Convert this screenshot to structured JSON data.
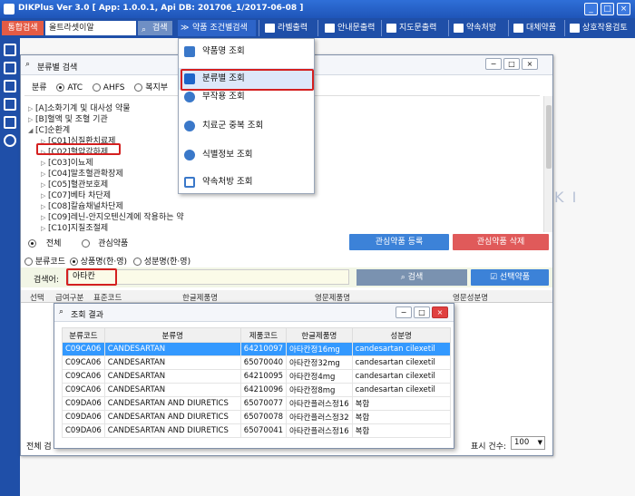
{
  "app": {
    "title": "DIKPlus Ver 3.0 [ App: 1.0.0.1, Api DB: 201706_1/2017-06-08 ]"
  },
  "toolbar": {
    "integrated_search": "통합검색",
    "search_value": "올트라셋이알",
    "search_btn": "검색",
    "drug_condition_search": "약품 조건별검색",
    "label_print": "라벨출력",
    "guide_print": "안내문출력",
    "guidance_print": "지도문출력",
    "contract_prescription": "약속처방",
    "substitute_drug": "대체약품",
    "interaction_review": "상호작용검토"
  },
  "dropdown": {
    "items": [
      "약품명 조회",
      "분류별 조회",
      "부작용 조회",
      "치료군 중복 조회",
      "식별정보 조회",
      "약속처방 조회"
    ]
  },
  "classwin": {
    "title": "분류별 검색",
    "cls_label": "분류",
    "opt_atc": "ATC",
    "opt_ahfs": "AHFS",
    "opt_welfare": "복지부",
    "tree": [
      "[A]소화기계 및 대사성 약물",
      "[B]혈액 및 조혈 기관",
      "[C]순환계",
      "[C01]심질환치료제",
      "[C02]혈압강하제",
      "[C03]이뇨제",
      "[C04]말초혈관확장제",
      "[C05]혈관보호제",
      "[C07]베타 차단제",
      "[C08]칼슘채널차단제",
      "[C09]레닌-안지오텐신계에 작용하는 약",
      "[C10]지질조절제"
    ],
    "all": "전체",
    "interest": "관심약품",
    "btn_add_interest": "관심약품 등록",
    "btn_del_interest": "관심약품 삭제",
    "opt_class_code": "분류코드",
    "opt_product_name": "상품명(한·영)",
    "opt_ingredient": "성분명(한·영)",
    "search_label": "검색어:",
    "search_value": "아타칸",
    "btn_search": "검색",
    "btn_select": "선택약품",
    "grid_headers": [
      "선택",
      "급여구분",
      "표준코드",
      "한글제품명",
      "영문제품명",
      "영문성분명"
    ],
    "footer_all": "전체 검",
    "display_count_label": "표시 건수:",
    "display_count_value": "100"
  },
  "popup": {
    "title": "조회 결과",
    "headers": [
      "분류코드",
      "분류명",
      "제품코드",
      "한글제품명",
      "성분명"
    ],
    "rows": [
      [
        "C09CA06",
        "CANDESARTAN",
        "64210097",
        "아타칸정16mg",
        "candesartan cilexetil"
      ],
      [
        "C09CA06",
        "CANDESARTAN",
        "65070040",
        "아타칸정32mg",
        "candesartan cilexetil"
      ],
      [
        "C09CA06",
        "CANDESARTAN",
        "64210095",
        "아타칸정4mg",
        "candesartan cilexetil"
      ],
      [
        "C09CA06",
        "CANDESARTAN",
        "64210096",
        "아타칸정8mg",
        "candesartan cilexetil"
      ],
      [
        "C09DA06",
        "CANDESARTAN AND DIURETICS",
        "65070077",
        "아타칸플러스정16",
        "복합"
      ],
      [
        "C09DA06",
        "CANDESARTAN AND DIURETICS",
        "65070078",
        "아타칸플러스정32",
        "복합"
      ],
      [
        "C09DA06",
        "CANDESARTAN AND DIURETICS",
        "65070041",
        "아타칸플러스정16",
        "복합"
      ]
    ]
  },
  "background": {
    "watermark": "DIK I"
  }
}
